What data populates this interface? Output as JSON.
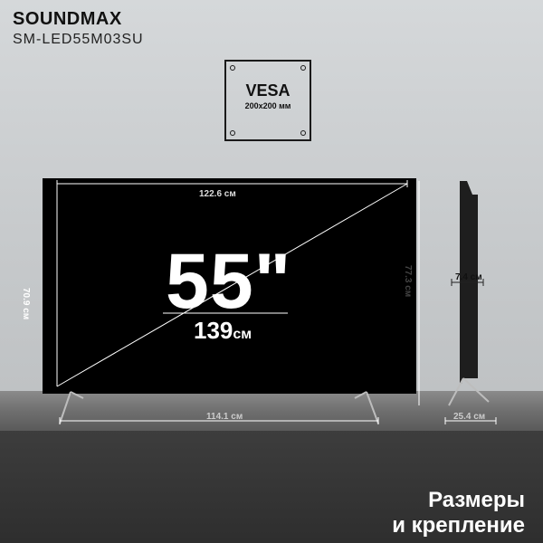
{
  "brand": "SOUNDMAX",
  "model": "SM-LED55M03SU",
  "vesa": {
    "title": "VESA",
    "size": "200x200 мм"
  },
  "diagonal": {
    "inches": "55\"",
    "cm_value": "139",
    "cm_unit": "см"
  },
  "dimensions": {
    "width": "122.6 см",
    "height": "70.9 см",
    "total_height": "77.3 см",
    "depth": "7.4 см",
    "base_width": "114.1 см",
    "stand_depth": "25.4 см"
  },
  "footer": {
    "line1": "Размеры",
    "line2": "и крепление"
  },
  "colors": {
    "screen": "#000000",
    "text_dark": "#111111",
    "shelf": "#6f6f6f"
  }
}
